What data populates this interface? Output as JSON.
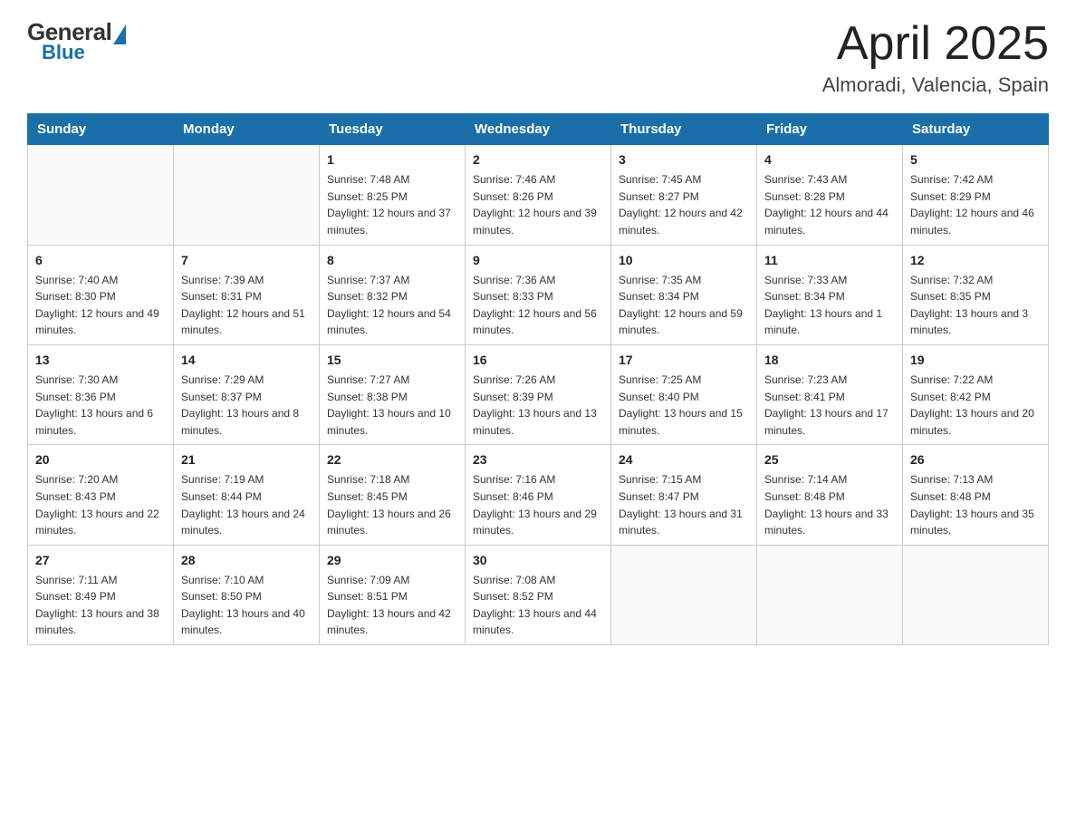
{
  "header": {
    "logo_general": "General",
    "logo_blue": "Blue",
    "month_title": "April 2025",
    "location": "Almoradi, Valencia, Spain"
  },
  "weekdays": [
    "Sunday",
    "Monday",
    "Tuesday",
    "Wednesday",
    "Thursday",
    "Friday",
    "Saturday"
  ],
  "weeks": [
    [
      {
        "day": "",
        "sunrise": "",
        "sunset": "",
        "daylight": ""
      },
      {
        "day": "",
        "sunrise": "",
        "sunset": "",
        "daylight": ""
      },
      {
        "day": "1",
        "sunrise": "Sunrise: 7:48 AM",
        "sunset": "Sunset: 8:25 PM",
        "daylight": "Daylight: 12 hours and 37 minutes."
      },
      {
        "day": "2",
        "sunrise": "Sunrise: 7:46 AM",
        "sunset": "Sunset: 8:26 PM",
        "daylight": "Daylight: 12 hours and 39 minutes."
      },
      {
        "day": "3",
        "sunrise": "Sunrise: 7:45 AM",
        "sunset": "Sunset: 8:27 PM",
        "daylight": "Daylight: 12 hours and 42 minutes."
      },
      {
        "day": "4",
        "sunrise": "Sunrise: 7:43 AM",
        "sunset": "Sunset: 8:28 PM",
        "daylight": "Daylight: 12 hours and 44 minutes."
      },
      {
        "day": "5",
        "sunrise": "Sunrise: 7:42 AM",
        "sunset": "Sunset: 8:29 PM",
        "daylight": "Daylight: 12 hours and 46 minutes."
      }
    ],
    [
      {
        "day": "6",
        "sunrise": "Sunrise: 7:40 AM",
        "sunset": "Sunset: 8:30 PM",
        "daylight": "Daylight: 12 hours and 49 minutes."
      },
      {
        "day": "7",
        "sunrise": "Sunrise: 7:39 AM",
        "sunset": "Sunset: 8:31 PM",
        "daylight": "Daylight: 12 hours and 51 minutes."
      },
      {
        "day": "8",
        "sunrise": "Sunrise: 7:37 AM",
        "sunset": "Sunset: 8:32 PM",
        "daylight": "Daylight: 12 hours and 54 minutes."
      },
      {
        "day": "9",
        "sunrise": "Sunrise: 7:36 AM",
        "sunset": "Sunset: 8:33 PM",
        "daylight": "Daylight: 12 hours and 56 minutes."
      },
      {
        "day": "10",
        "sunrise": "Sunrise: 7:35 AM",
        "sunset": "Sunset: 8:34 PM",
        "daylight": "Daylight: 12 hours and 59 minutes."
      },
      {
        "day": "11",
        "sunrise": "Sunrise: 7:33 AM",
        "sunset": "Sunset: 8:34 PM",
        "daylight": "Daylight: 13 hours and 1 minute."
      },
      {
        "day": "12",
        "sunrise": "Sunrise: 7:32 AM",
        "sunset": "Sunset: 8:35 PM",
        "daylight": "Daylight: 13 hours and 3 minutes."
      }
    ],
    [
      {
        "day": "13",
        "sunrise": "Sunrise: 7:30 AM",
        "sunset": "Sunset: 8:36 PM",
        "daylight": "Daylight: 13 hours and 6 minutes."
      },
      {
        "day": "14",
        "sunrise": "Sunrise: 7:29 AM",
        "sunset": "Sunset: 8:37 PM",
        "daylight": "Daylight: 13 hours and 8 minutes."
      },
      {
        "day": "15",
        "sunrise": "Sunrise: 7:27 AM",
        "sunset": "Sunset: 8:38 PM",
        "daylight": "Daylight: 13 hours and 10 minutes."
      },
      {
        "day": "16",
        "sunrise": "Sunrise: 7:26 AM",
        "sunset": "Sunset: 8:39 PM",
        "daylight": "Daylight: 13 hours and 13 minutes."
      },
      {
        "day": "17",
        "sunrise": "Sunrise: 7:25 AM",
        "sunset": "Sunset: 8:40 PM",
        "daylight": "Daylight: 13 hours and 15 minutes."
      },
      {
        "day": "18",
        "sunrise": "Sunrise: 7:23 AM",
        "sunset": "Sunset: 8:41 PM",
        "daylight": "Daylight: 13 hours and 17 minutes."
      },
      {
        "day": "19",
        "sunrise": "Sunrise: 7:22 AM",
        "sunset": "Sunset: 8:42 PM",
        "daylight": "Daylight: 13 hours and 20 minutes."
      }
    ],
    [
      {
        "day": "20",
        "sunrise": "Sunrise: 7:20 AM",
        "sunset": "Sunset: 8:43 PM",
        "daylight": "Daylight: 13 hours and 22 minutes."
      },
      {
        "day": "21",
        "sunrise": "Sunrise: 7:19 AM",
        "sunset": "Sunset: 8:44 PM",
        "daylight": "Daylight: 13 hours and 24 minutes."
      },
      {
        "day": "22",
        "sunrise": "Sunrise: 7:18 AM",
        "sunset": "Sunset: 8:45 PM",
        "daylight": "Daylight: 13 hours and 26 minutes."
      },
      {
        "day": "23",
        "sunrise": "Sunrise: 7:16 AM",
        "sunset": "Sunset: 8:46 PM",
        "daylight": "Daylight: 13 hours and 29 minutes."
      },
      {
        "day": "24",
        "sunrise": "Sunrise: 7:15 AM",
        "sunset": "Sunset: 8:47 PM",
        "daylight": "Daylight: 13 hours and 31 minutes."
      },
      {
        "day": "25",
        "sunrise": "Sunrise: 7:14 AM",
        "sunset": "Sunset: 8:48 PM",
        "daylight": "Daylight: 13 hours and 33 minutes."
      },
      {
        "day": "26",
        "sunrise": "Sunrise: 7:13 AM",
        "sunset": "Sunset: 8:48 PM",
        "daylight": "Daylight: 13 hours and 35 minutes."
      }
    ],
    [
      {
        "day": "27",
        "sunrise": "Sunrise: 7:11 AM",
        "sunset": "Sunset: 8:49 PM",
        "daylight": "Daylight: 13 hours and 38 minutes."
      },
      {
        "day": "28",
        "sunrise": "Sunrise: 7:10 AM",
        "sunset": "Sunset: 8:50 PM",
        "daylight": "Daylight: 13 hours and 40 minutes."
      },
      {
        "day": "29",
        "sunrise": "Sunrise: 7:09 AM",
        "sunset": "Sunset: 8:51 PM",
        "daylight": "Daylight: 13 hours and 42 minutes."
      },
      {
        "day": "30",
        "sunrise": "Sunrise: 7:08 AM",
        "sunset": "Sunset: 8:52 PM",
        "daylight": "Daylight: 13 hours and 44 minutes."
      },
      {
        "day": "",
        "sunrise": "",
        "sunset": "",
        "daylight": ""
      },
      {
        "day": "",
        "sunrise": "",
        "sunset": "",
        "daylight": ""
      },
      {
        "day": "",
        "sunrise": "",
        "sunset": "",
        "daylight": ""
      }
    ]
  ]
}
